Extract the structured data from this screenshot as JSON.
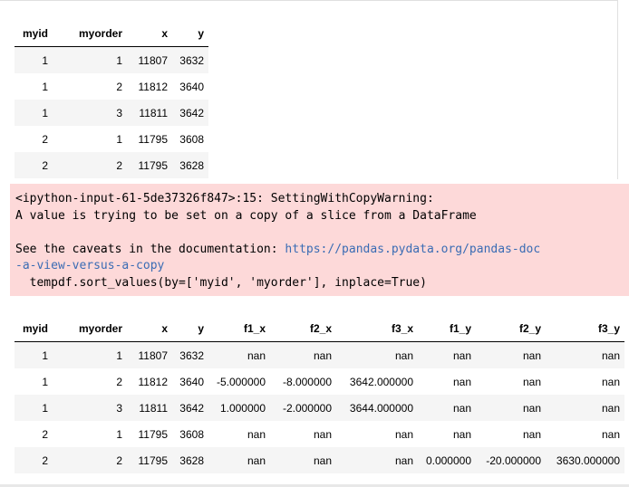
{
  "table1": {
    "columns": [
      "myid",
      "myorder",
      "x",
      "y"
    ],
    "rows": [
      [
        "1",
        "1",
        "11807",
        "3632"
      ],
      [
        "1",
        "2",
        "11812",
        "3640"
      ],
      [
        "1",
        "3",
        "11811",
        "3642"
      ],
      [
        "2",
        "1",
        "11795",
        "3608"
      ],
      [
        "2",
        "2",
        "11795",
        "3628"
      ]
    ]
  },
  "warning": {
    "line1": "<ipython-input-61-5de37326f847>:15: SettingWithCopyWarning:",
    "line2": "A value is trying to be set on a copy of a slice from a DataFrame",
    "line3_prefix": "See the caveats in the documentation: ",
    "line3_link": "https://pandas.pydata.org/pandas-doc",
    "line4_link": "-a-view-versus-a-copy",
    "line5": "  tempdf.sort_values(by=['myid', 'myorder'], inplace=True)"
  },
  "table2": {
    "columns": [
      "myid",
      "myorder",
      "x",
      "y",
      "f1_x",
      "f2_x",
      "f3_x",
      "f1_y",
      "f2_y",
      "f3_y"
    ],
    "rows": [
      [
        "1",
        "1",
        "11807",
        "3632",
        "nan",
        "nan",
        "nan",
        "nan",
        "nan",
        "nan"
      ],
      [
        "1",
        "2",
        "11812",
        "3640",
        "-5.000000",
        "-8.000000",
        "3642.000000",
        "nan",
        "nan",
        "nan"
      ],
      [
        "1",
        "3",
        "11811",
        "3642",
        "1.000000",
        "-2.000000",
        "3644.000000",
        "nan",
        "nan",
        "nan"
      ],
      [
        "2",
        "1",
        "11795",
        "3608",
        "nan",
        "nan",
        "nan",
        "nan",
        "nan",
        "nan"
      ],
      [
        "2",
        "2",
        "11795",
        "3628",
        "nan",
        "nan",
        "nan",
        "0.000000",
        "-20.000000",
        "3630.000000"
      ]
    ]
  },
  "colors": {
    "warning_bg": "#fdd9d9",
    "link": "#3a6cb4",
    "stripe": "#f5f5f5"
  }
}
